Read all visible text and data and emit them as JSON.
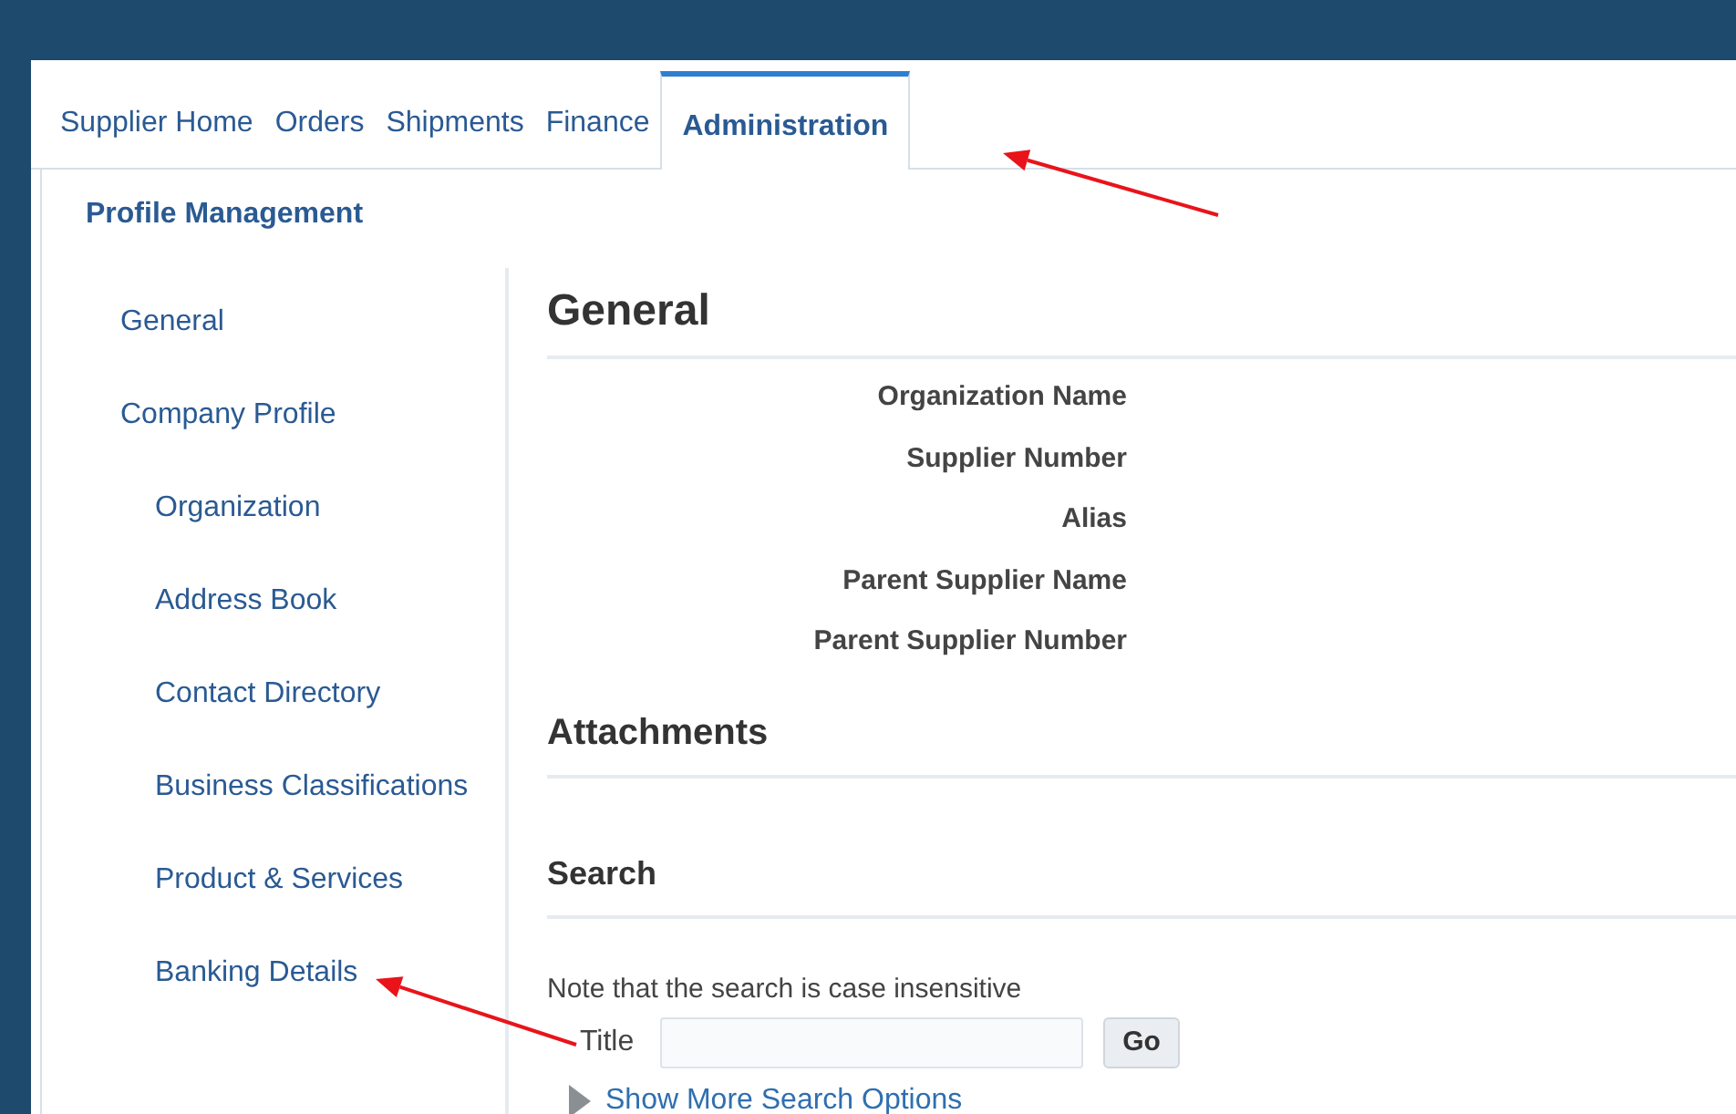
{
  "tabs": [
    {
      "label": "Supplier Home",
      "selected": false
    },
    {
      "label": "Orders",
      "selected": false
    },
    {
      "label": "Shipments",
      "selected": false
    },
    {
      "label": "Finance",
      "selected": false
    },
    {
      "label": "Administration",
      "selected": true
    }
  ],
  "subtab": {
    "label": "Profile Management"
  },
  "sidebar": {
    "items": [
      {
        "label": "General"
      },
      {
        "label": "Company Profile",
        "children": [
          {
            "label": "Organization"
          },
          {
            "label": "Address Book"
          },
          {
            "label": "Contact Directory"
          },
          {
            "label": "Business Classifications"
          },
          {
            "label": "Product & Services"
          },
          {
            "label": "Banking Details"
          }
        ]
      }
    ]
  },
  "general": {
    "heading": "General",
    "fields": [
      {
        "label": "Organization Name"
      },
      {
        "label": "Supplier Number"
      },
      {
        "label": "Alias"
      },
      {
        "label": "Parent Supplier Name"
      },
      {
        "label": "Parent Supplier Number"
      }
    ]
  },
  "attachments": {
    "heading": "Attachments"
  },
  "search": {
    "heading": "Search",
    "note": "Note that the search is case insensitive",
    "title_label": "Title",
    "go_button": "Go",
    "more_options": "Show More Search Options"
  },
  "annotations": [
    {
      "kind": "arrow"
    },
    {
      "kind": "arrow"
    }
  ]
}
